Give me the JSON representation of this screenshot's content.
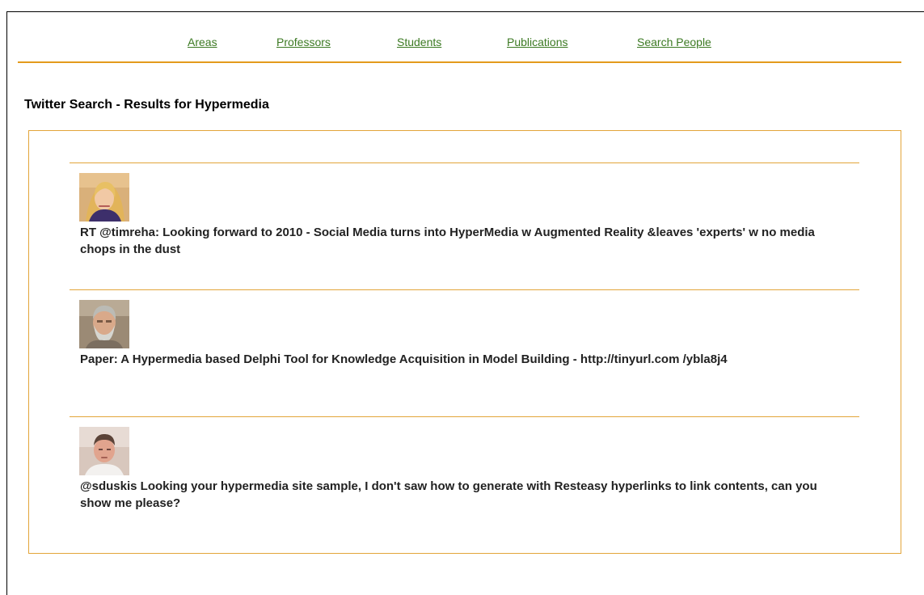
{
  "nav": {
    "items": [
      {
        "label": "Areas"
      },
      {
        "label": "Professors"
      },
      {
        "label": "Students"
      },
      {
        "label": "Publications"
      },
      {
        "label": "Search People"
      }
    ]
  },
  "page": {
    "title": "Twitter Search - Results for Hypermedia"
  },
  "results": [
    {
      "avatar_icon": "user-avatar-blonde-woman",
      "text": "RT @timreha: Looking forward to 2010 - Social Media turns into HyperMedia w Augmented Reality &leaves 'experts' w no media chops in the dust"
    },
    {
      "avatar_icon": "user-avatar-gray-bearded-man",
      "text": "Paper: A Hypermedia based Delphi Tool for Knowledge Acquisition in Model Building - http://tinyurl.com /ybla8j4"
    },
    {
      "avatar_icon": "user-avatar-young-man",
      "text": "@sduskis Looking your hypermedia site sample, I don't saw how to generate with Resteasy hyperlinks to link contents, can you show me please?"
    }
  ],
  "colors": {
    "accent": "#e39a1c",
    "link": "#3c7a23",
    "border": "#e3a53a",
    "frame": "#000000"
  }
}
